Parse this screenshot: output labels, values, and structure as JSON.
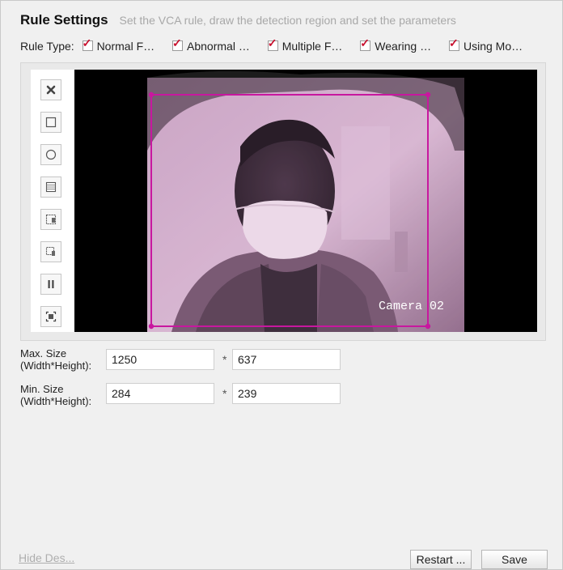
{
  "header": {
    "title": "Rule Settings",
    "subtitle": "Set the VCA rule, draw the detection region and set the parameters"
  },
  "rule_type": {
    "label": "Rule Type:",
    "options": [
      {
        "label": "Normal F…",
        "checked": true
      },
      {
        "label": "Abnormal …",
        "checked": true
      },
      {
        "label": "Multiple F…",
        "checked": true
      },
      {
        "label": "Wearing …",
        "checked": true
      },
      {
        "label": "Using Mo…",
        "checked": true
      }
    ]
  },
  "toolbar": {
    "tools": [
      "clear-icon",
      "rectangle-icon",
      "circle-icon",
      "grid-icon",
      "max-size-icon",
      "min-size-icon",
      "pause-icon",
      "fullscreen-icon"
    ]
  },
  "video": {
    "overlay_text": "Camera 02",
    "region_color": "#c8179f"
  },
  "sizes": {
    "max": {
      "label_line1": "Max. Size",
      "label_line2": "(Width*Height):",
      "width": "1250",
      "height": "637"
    },
    "min": {
      "label_line1": "Min. Size",
      "label_line2": "(Width*Height):",
      "width": "284",
      "height": "239"
    },
    "separator": "*"
  },
  "footer": {
    "hide_link": "Hide Des...",
    "restart_label": "Restart ...",
    "save_label": "Save"
  }
}
